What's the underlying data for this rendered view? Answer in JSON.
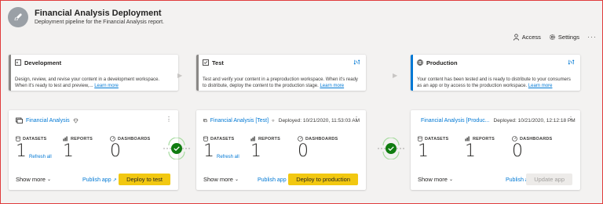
{
  "header": {
    "title": "Financial Analysis Deployment",
    "subtitle": "Deployment pipeline for the Financial Analysis report.",
    "logo_icon": "rocket-icon"
  },
  "top_actions": {
    "access": "Access",
    "settings": "Settings",
    "more": "···"
  },
  "stages": [
    {
      "name": "Development",
      "desc": "Design, review, and revise your content in a development workspace. When it's ready to test and preview,...",
      "link": "Learn more",
      "icon": "development-icon"
    },
    {
      "name": "Test",
      "desc": "Test and verify your content in a preproduction workspace. When it's ready to distribute, deploy the content to the production stage.",
      "link": "Learn more",
      "icon": "test-icon",
      "has_compare": true
    },
    {
      "name": "Production",
      "desc": "Your content has been tested and is ready to distribute to your consumers as an app or by access to the production workspace.",
      "link": "Learn more",
      "icon": "production-icon",
      "has_compare": true
    }
  ],
  "cards": [
    {
      "workspace": "Financial Analysis",
      "deployed": "",
      "datasets_label": "DATASETS",
      "reports_label": "REPORTS",
      "dashboards_label": "DASHBOARDS",
      "datasets": "1",
      "reports": "1",
      "dashboards": "0",
      "refresh": "Refresh all",
      "show_more": "Show more",
      "publish": "Publish app",
      "action": "Deploy to test"
    },
    {
      "workspace": "Financial Analysis [Test]",
      "deployed": "Deployed: 10/21/2020, 11:53:03 AM",
      "datasets_label": "DATASETS",
      "reports_label": "REPORTS",
      "dashboards_label": "DASHBOARDS",
      "datasets": "1",
      "reports": "1",
      "dashboards": "0",
      "refresh": "Refresh all",
      "show_more": "Show more",
      "publish": "Publish app",
      "action": "Deploy to production"
    },
    {
      "workspace": "Financial Analysis [Produc...",
      "deployed": "Deployed: 10/21/2020, 12:12:18 PM",
      "datasets_label": "DATASETS",
      "reports_label": "REPORTS",
      "dashboards_label": "DASHBOARDS",
      "datasets": "1",
      "reports": "1",
      "dashboards": "0",
      "refresh": "",
      "show_more": "Show more",
      "publish": "Publish app",
      "action": "Update app"
    }
  ],
  "colors": {
    "accent": "#0078d4",
    "deploy_button": "#f2c811",
    "sync_ok": "#107c10"
  }
}
